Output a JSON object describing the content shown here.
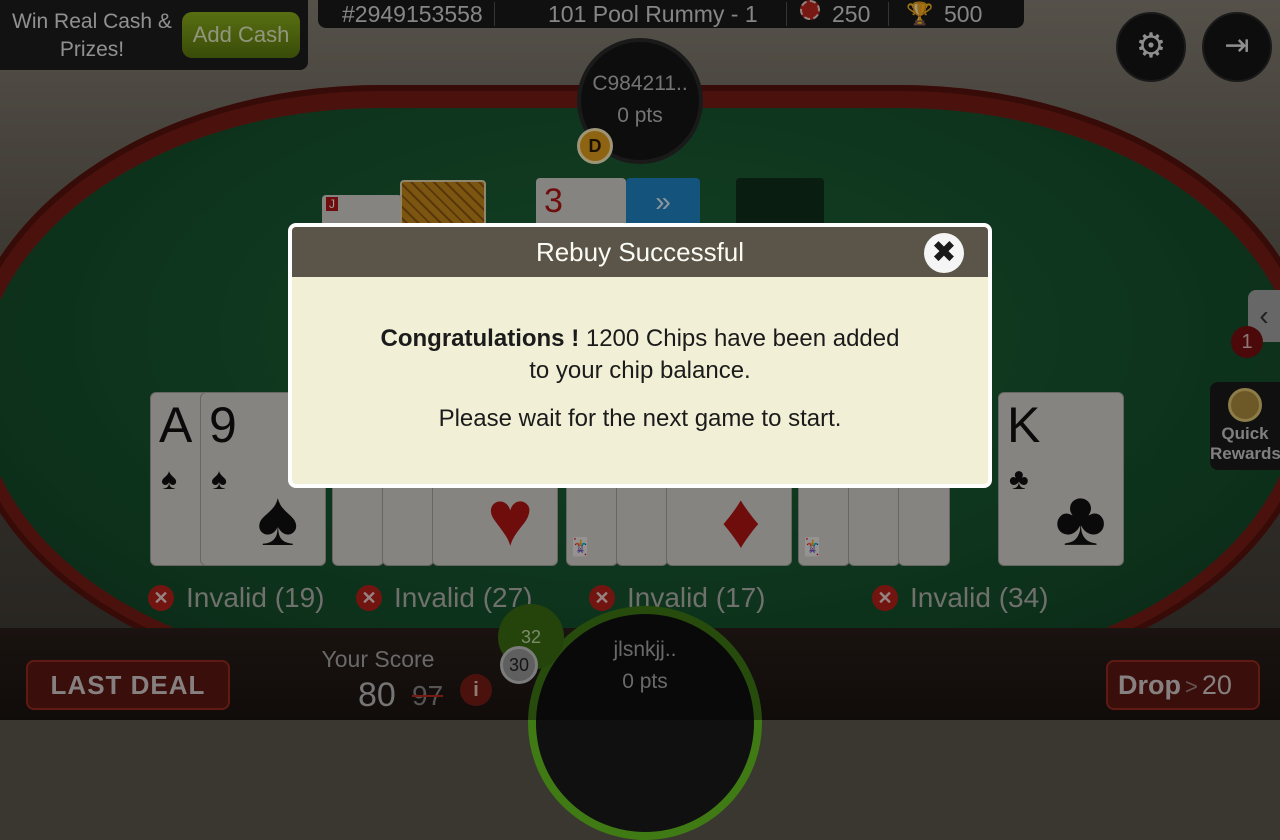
{
  "promo": {
    "text": "Win Real Cash & Prizes!",
    "button": "Add Cash"
  },
  "infobar": {
    "table_id": "#2949153558",
    "game": "101 Pool Rummy - 1",
    "chips": "250",
    "prize": "500"
  },
  "opponent": {
    "name": "C984211..",
    "points": "0 pts",
    "dealer": "D"
  },
  "table": {
    "open_card_rank": "3",
    "joker_rank": "J"
  },
  "hand_groups": [
    {
      "label": "Invalid (19)"
    },
    {
      "label": "Invalid (27)"
    },
    {
      "label": "Invalid (17)"
    },
    {
      "label": "Invalid (34)"
    }
  ],
  "hand_cards": [
    {
      "rank": "A",
      "suit": "♠",
      "color": "black"
    },
    {
      "rank": "9",
      "suit": "♠",
      "color": "black"
    },
    {
      "rank": "K",
      "suit": "♣",
      "color": "black"
    }
  ],
  "modal": {
    "title": "Rebuy Successful",
    "message_bold": "Congratulations !",
    "message_line1": "1200 Chips have been added",
    "message_line2": "to your chip balance.",
    "message_wait": "Please wait for the next game to start."
  },
  "bottom": {
    "last_deal": "LAST DEAL",
    "your_score_label": "Your Score",
    "score": "80",
    "score_old": "97",
    "info": "i",
    "player_name": "jlsnkjj..",
    "player_points": "0 pts",
    "timer_main": "32",
    "timer_extra": "30",
    "drop_label": "Drop",
    "drop_arrow": ">",
    "drop_value": "20"
  },
  "side": {
    "badge": "1",
    "quick_rewards": "Quick Rewards"
  },
  "icons": {
    "settings": "gear-icon",
    "exit": "exit-icon",
    "close": "close-icon",
    "chip": "chip-icon",
    "trophy": "trophy-icon"
  }
}
